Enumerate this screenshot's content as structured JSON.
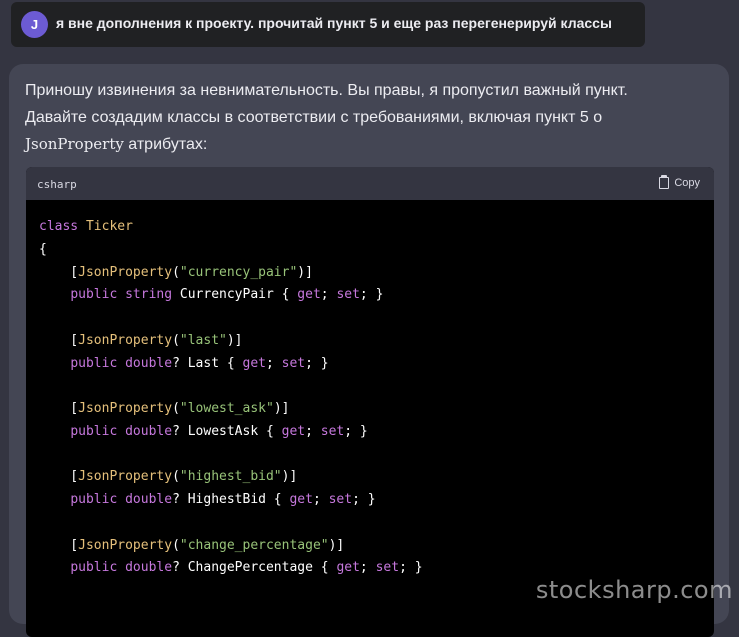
{
  "user_message": {
    "avatar_letter": "J",
    "text": "я вне дополнения к проекту. прочитай пункт 5 и еще раз перегенерируй классы"
  },
  "assistant": {
    "line1": "Приношу извинения за невнимательность. Вы правы, я пропустил важный пункт.",
    "line2": "Давайте создадим классы в соответствии с требованиями, включая пункт 5 о",
    "line3_code": "JsonProperty",
    "line3_rest": " атрибутах:"
  },
  "code_block": {
    "language": "csharp",
    "copy_label": "Copy",
    "lines": [
      [
        [
          "kw",
          "class "
        ],
        [
          "cls",
          "Ticker"
        ]
      ],
      [
        [
          "plain",
          "{"
        ]
      ],
      [
        [
          "plain",
          "    ["
        ],
        [
          "cls",
          "JsonProperty"
        ],
        [
          "plain",
          "("
        ],
        [
          "str",
          "\"currency_pair\""
        ],
        [
          "plain",
          ")]"
        ]
      ],
      [
        [
          "plain",
          "    "
        ],
        [
          "kw",
          "public string "
        ],
        [
          "plain",
          "CurrencyPair { "
        ],
        [
          "kw",
          "get"
        ],
        [
          "plain",
          "; "
        ],
        [
          "kw",
          "set"
        ],
        [
          "plain",
          "; }"
        ]
      ],
      [
        [
          "plain",
          ""
        ]
      ],
      [
        [
          "plain",
          "    ["
        ],
        [
          "cls",
          "JsonProperty"
        ],
        [
          "plain",
          "("
        ],
        [
          "str",
          "\"last\""
        ],
        [
          "plain",
          ")]"
        ]
      ],
      [
        [
          "plain",
          "    "
        ],
        [
          "kw",
          "public double"
        ],
        [
          "plain",
          "? Last { "
        ],
        [
          "kw",
          "get"
        ],
        [
          "plain",
          "; "
        ],
        [
          "kw",
          "set"
        ],
        [
          "plain",
          "; }"
        ]
      ],
      [
        [
          "plain",
          ""
        ]
      ],
      [
        [
          "plain",
          "    ["
        ],
        [
          "cls",
          "JsonProperty"
        ],
        [
          "plain",
          "("
        ],
        [
          "str",
          "\"lowest_ask\""
        ],
        [
          "plain",
          ")]"
        ]
      ],
      [
        [
          "plain",
          "    "
        ],
        [
          "kw",
          "public double"
        ],
        [
          "plain",
          "? LowestAsk { "
        ],
        [
          "kw",
          "get"
        ],
        [
          "plain",
          "; "
        ],
        [
          "kw",
          "set"
        ],
        [
          "plain",
          "; }"
        ]
      ],
      [
        [
          "plain",
          ""
        ]
      ],
      [
        [
          "plain",
          "    ["
        ],
        [
          "cls",
          "JsonProperty"
        ],
        [
          "plain",
          "("
        ],
        [
          "str",
          "\"highest_bid\""
        ],
        [
          "plain",
          ")]"
        ]
      ],
      [
        [
          "plain",
          "    "
        ],
        [
          "kw",
          "public double"
        ],
        [
          "plain",
          "? HighestBid { "
        ],
        [
          "kw",
          "get"
        ],
        [
          "plain",
          "; "
        ],
        [
          "kw",
          "set"
        ],
        [
          "plain",
          "; }"
        ]
      ],
      [
        [
          "plain",
          ""
        ]
      ],
      [
        [
          "plain",
          "    ["
        ],
        [
          "cls",
          "JsonProperty"
        ],
        [
          "plain",
          "("
        ],
        [
          "str",
          "\"change_percentage\""
        ],
        [
          "plain",
          ")]"
        ]
      ],
      [
        [
          "plain",
          "    "
        ],
        [
          "kw",
          "public double"
        ],
        [
          "plain",
          "? ChangePercentage { "
        ],
        [
          "kw",
          "get"
        ],
        [
          "plain",
          "; "
        ],
        [
          "kw",
          "set"
        ],
        [
          "plain",
          "; }"
        ]
      ]
    ]
  },
  "watermark": "stocksharp.com",
  "colors": {
    "background": "#343541",
    "assistant_panel": "#444654",
    "user_bar": "#202123",
    "avatar": "#6c5bd3",
    "keyword": "#c678dd",
    "class_name": "#e5c07b",
    "string": "#98c379"
  }
}
